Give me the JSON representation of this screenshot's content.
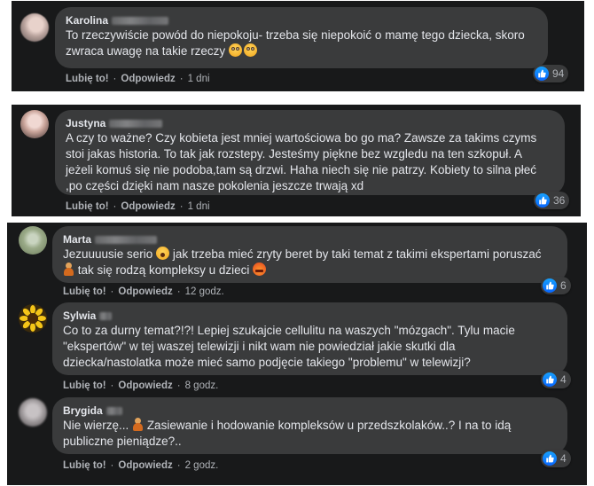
{
  "comments": [
    {
      "name": "Karolina",
      "lines": [
        "To rzeczywiście powód do niepokoju- trzeba się niepokoić o mamę tego dziecka, skoro",
        "zwraca uwagę na takie rzeczy"
      ],
      "emoji_trailing": [
        "flushed-face-emoji",
        "flushed-face-emoji"
      ],
      "like_label": "Lubię to!",
      "reply_label": "Odpowiedz",
      "separator": "·",
      "time": "1 dni",
      "reaction_count": "94"
    },
    {
      "name": "Justyna",
      "lines": [
        "A czy to ważne? Czy kobieta jest mniej wartościowa bo go ma? Zawsze za takims czyms",
        "stoi jakas historia. To tak jak rozstepy. Jesteśmy piękne bez wzgledu na ten szkopuł. A",
        "jeżeli komuś się nie podoba,tam są drzwi. Haha niech się nie patrzy. Kobiety to silna płeć",
        ",po części dzięki nam nasze pokolenia jeszcze trwają xd"
      ],
      "like_label": "Lubię to!",
      "reply_label": "Odpowiedz",
      "separator": "·",
      "time": "1 dni",
      "reaction_count": "36"
    },
    {
      "name": "Marta",
      "line1_a": "Jezuuuusie serio",
      "line1_b": "jak trzeba mieć zryty beret by taki temat z takimi ekspertami poruszać",
      "line2": "tak się rodzą kompleksy u dzieci",
      "like_label": "Lubię to!",
      "reply_label": "Odpowiedz",
      "separator": "·",
      "time": "12 godz.",
      "reaction_count": "6"
    },
    {
      "name": "Sylwia",
      "lines": [
        "Co to za durny temat?!?! Lepiej szukajcie cellulitu na waszych \"mózgach\". Tylu macie",
        "\"ekspertów\" w tej waszej telewizji i nikt wam nie powiedział jakie skutki dla",
        "dziecka/nastolatka może mieć samo podjęcie takiego \"problemu\" w telewizji?"
      ],
      "like_label": "Lubię to!",
      "reply_label": "Odpowiedz",
      "separator": "·",
      "time": "8 godz.",
      "reaction_count": "4"
    },
    {
      "name": "Brygida",
      "line1_a": "Nie wierzę...",
      "line1_b": "Zasiewanie i hodowanie kompleksów u przedszkolaków..? I na to idą",
      "line2": "publiczne pieniądze?..",
      "like_label": "Lubię to!",
      "reply_label": "Odpowiedz",
      "separator": "·",
      "time": "2 godz.",
      "reaction_count": "4"
    }
  ],
  "colors": {
    "panel_bg": "#18191a",
    "bubble_bg": "#3a3b3c",
    "text_primary": "#e4e6eb",
    "text_secondary": "#b0b3b8",
    "like_blue": "#0866ff"
  }
}
